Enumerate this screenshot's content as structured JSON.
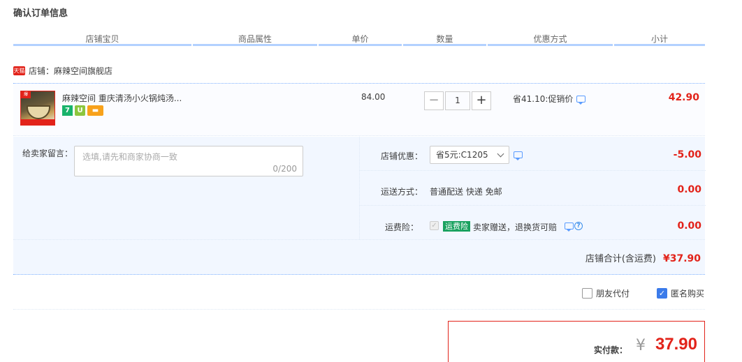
{
  "page_title": "确认订单信息",
  "columns": [
    "店铺宝贝",
    "商品属性",
    "单价",
    "数量",
    "优惠方式",
    "小计"
  ],
  "shop": {
    "logo_text": "天猫",
    "name": "店铺：麻辣空间旗舰店"
  },
  "item": {
    "title": "麻辣空间 重庆清汤小火锅炖汤...",
    "thumb_tag": "爆",
    "badges": {
      "seven": "7",
      "shield": "U",
      "card": "▬"
    },
    "unit_price": "84.00",
    "quantity": "1",
    "qty_minus": "−",
    "qty_plus": "+",
    "promo": "省41.10:促销价",
    "subtotal": "42.90"
  },
  "message": {
    "label": "给卖家留言：",
    "placeholder": "选填,请先和商家协商一致",
    "count": "0/200"
  },
  "options": {
    "shop_discount": {
      "label": "店铺优惠：",
      "value": "省5元:C1205",
      "amount": "-5.00"
    },
    "shipping": {
      "label": "运送方式：",
      "value": "普通配送 快递 免邮",
      "amount": "0.00"
    },
    "insurance": {
      "label": "运费险：",
      "badge": "运费险",
      "text": "卖家赠送，退换货可赔",
      "help": "?",
      "amount": "0.00"
    }
  },
  "shop_total": {
    "label": "店铺合计(含运费)",
    "value": "¥37.90"
  },
  "checkboxes": {
    "friend_pay": "朋友代付",
    "anonymous": "匿名购买"
  },
  "payment": {
    "label": "实付款：",
    "currency": "¥",
    "value": "37.90"
  },
  "colors": {
    "accent_red": "#e2231a",
    "header_line": "#b2d1ff",
    "panel_bg": "#f2f7ff"
  }
}
